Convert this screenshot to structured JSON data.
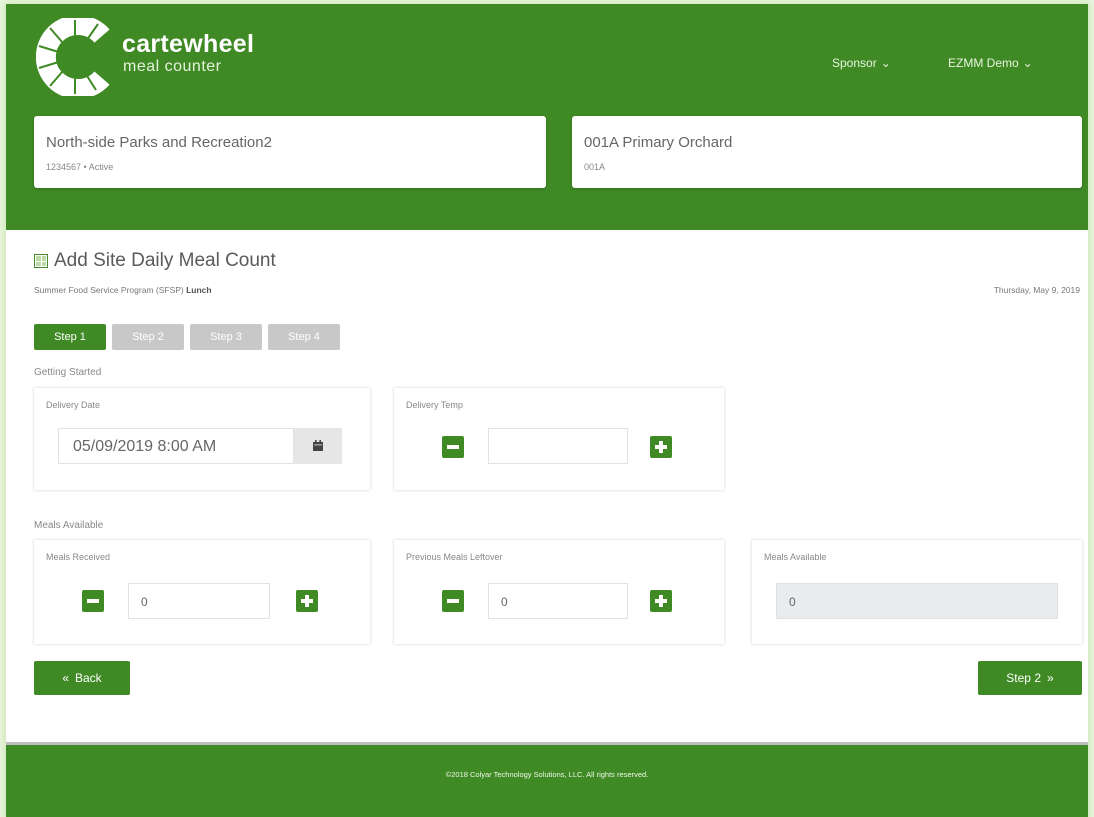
{
  "brand": {
    "name": "cartewheel",
    "sub": "meal counter"
  },
  "topnav": {
    "sponsor": "Sponsor",
    "user": "EZMM Demo"
  },
  "sponsor_card": {
    "title": "North-side Parks and Recreation2",
    "sub": "1234567 • Active"
  },
  "site_card": {
    "title": "001A Primary Orchard",
    "sub": "001A"
  },
  "page": {
    "title": "Add Site Daily Meal Count",
    "program_prefix": "Summer Food Service Program (SFSP) ",
    "program_meal": "Lunch",
    "date": "Thursday, May 9, 2019"
  },
  "steps": [
    "Step 1",
    "Step 2",
    "Step 3",
    "Step 4"
  ],
  "getting_started": {
    "label": "Getting Started",
    "delivery_date_label": "Delivery Date",
    "delivery_date_value": "05/09/2019 8:00 AM",
    "delivery_temp_label": "Delivery Temp",
    "delivery_temp_value": ""
  },
  "meals": {
    "label": "Meals Available",
    "received_label": "Meals Received",
    "received_value": "0",
    "leftover_label": "Previous Meals Leftover",
    "leftover_value": "0",
    "available_label": "Meals Available",
    "available_value": "0"
  },
  "nav": {
    "back": "Back",
    "next": "Step 2"
  },
  "footer": "©2018 Colyar Technology Solutions, LLC. All rights reserved.",
  "colors": {
    "brand_green": "#3f8a25",
    "inactive_step": "#c8c8c8"
  }
}
